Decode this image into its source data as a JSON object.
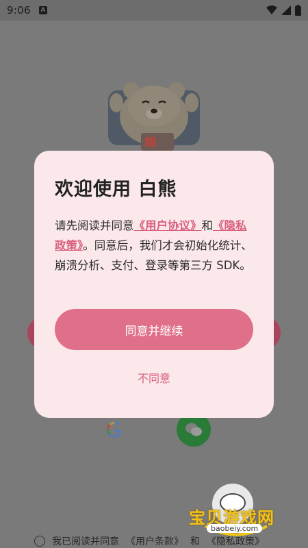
{
  "status_bar": {
    "time": "9:06",
    "app_icon": "A",
    "icons": [
      "wifi-icon",
      "signal-icon",
      "battery-icon"
    ]
  },
  "background": {
    "agree_text": "我已阅读并同意",
    "terms_link": "《用户条款》",
    "and_text": "和",
    "privacy_link": "《隐私政策》",
    "watermark_text": "宝贝游戏网",
    "watermark_url": "baobeiy.com"
  },
  "dialog": {
    "title": "欢迎使用 白熊",
    "body_prefix": "请先阅读并同意",
    "user_agreement": "《用户协议》",
    "and": "和",
    "privacy_policy": "《隐私政策》",
    "body_suffix": "。同意后，我们才会初始化统计、崩溃分析、支付、登录等第三方 SDK。",
    "agree_button": "同意并继续",
    "disagree_button": "不同意"
  },
  "colors": {
    "accent": "#e0708a",
    "link": "#d9607f",
    "dialog_bg": "#fbe8ea",
    "scrim": "#7a7a7a"
  }
}
